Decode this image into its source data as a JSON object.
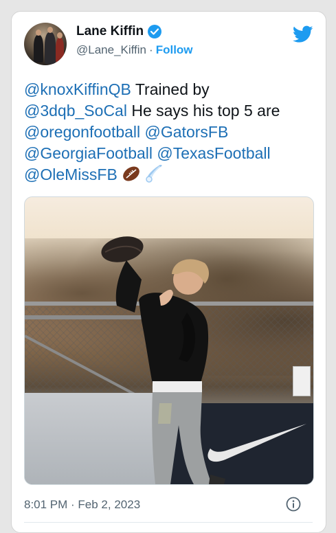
{
  "author": {
    "name": "Lane Kiffin",
    "handle": "@Lane_Kiffin",
    "separator": "·",
    "follow_label": "Follow"
  },
  "icons": {
    "verified": "verified-badge-icon",
    "brand": "twitter-bird-icon",
    "football": "football-emoji",
    "comet": "comet-emoji",
    "info": "info-icon"
  },
  "tweet": {
    "m1": "@knoxKiffinQB",
    "t1": " Trained by",
    "m2": "@3dqb_SoCal",
    "t2": " He says his top 5 are",
    "m3": "@oregonfootball",
    "m4": "@GatorsFB",
    "m5": "@GeorgiaFootball",
    "m6": "@TexasFootball",
    "m7": "@OleMissFB"
  },
  "footer": {
    "timestamp": "8:01 PM · Feb 2, 2023"
  },
  "colors": {
    "accent": "#1d9bf0",
    "mention": "#1d6fb5",
    "text": "#0f1419",
    "secondary": "#536471"
  }
}
